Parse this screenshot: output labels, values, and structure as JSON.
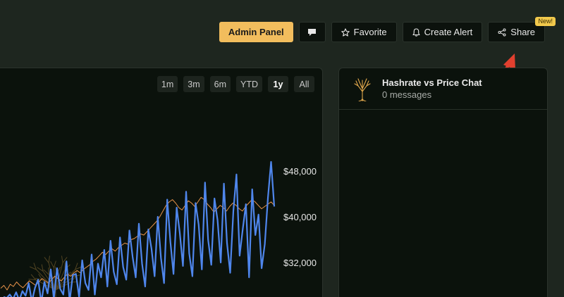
{
  "toolbar": {
    "admin_label": "Admin Panel",
    "comment_icon": "comment-icon",
    "favorite_label": "Favorite",
    "favorite_icon": "star-icon",
    "alert_label": "Create Alert",
    "alert_icon": "bell-icon",
    "share_label": "Share",
    "share_icon": "share-icon",
    "share_badge": "New!"
  },
  "ranges": [
    {
      "label": "1m",
      "active": false
    },
    {
      "label": "3m",
      "active": false
    },
    {
      "label": "6m",
      "active": false
    },
    {
      "label": "YTD",
      "active": false
    },
    {
      "label": "1y",
      "active": true
    },
    {
      "label": "All",
      "active": false
    }
  ],
  "chart_data": {
    "type": "line",
    "title": "",
    "xlabel": "",
    "ylabel": "",
    "ylim": [
      26000,
      52000
    ],
    "y_ticks": [
      "$48,000",
      "$40,000",
      "$32,000"
    ],
    "y_tick_values": [
      48000,
      40000,
      32000
    ],
    "series": [
      {
        "color": "#e8934a",
        "values": [
          27500,
          28000,
          27200,
          28200,
          27800,
          28600,
          28000,
          27600,
          28200,
          28800,
          28400,
          28000,
          28600,
          29200,
          28800,
          28400,
          29000,
          29600,
          29200,
          28800,
          29400,
          30000,
          29600,
          30200,
          30600,
          30200,
          30800,
          31200,
          31600,
          32200,
          32600,
          33200,
          33800,
          33400,
          34000,
          34400,
          34000,
          34600,
          35000,
          35400,
          35200,
          36000,
          36200,
          36600,
          37000,
          36800,
          37400,
          38000,
          38600,
          39200,
          40000,
          41000,
          42000,
          42600,
          43000,
          42400,
          41600,
          41200,
          42000,
          42800,
          42400,
          41800,
          42600,
          43400,
          43000,
          42200,
          41600,
          40800,
          41400,
          42000,
          41600,
          41000,
          41800,
          42400,
          42000,
          41400,
          41000,
          41800,
          42400,
          43000,
          42600,
          42000,
          41400,
          41800,
          42200,
          42600,
          42000
        ]
      },
      {
        "color": "#4f86ec",
        "values": [
          26000,
          25800,
          26400,
          25600,
          26800,
          25400,
          27000,
          26200,
          28400,
          25200,
          27600,
          29000,
          25000,
          28600,
          26600,
          30800,
          25600,
          31000,
          27400,
          26400,
          32200,
          25200,
          29800,
          30000,
          26000,
          32400,
          28400,
          27200,
          33400,
          26400,
          31800,
          29400,
          34200,
          27800,
          35800,
          30400,
          28200,
          36400,
          31200,
          29000,
          37600,
          33000,
          29400,
          38800,
          31800,
          27800,
          37800,
          34400,
          29600,
          40000,
          32800,
          28400,
          43000,
          35600,
          30000,
          41600,
          37200,
          31400,
          44400,
          33600,
          29600,
          42400,
          38600,
          30800,
          46000,
          36000,
          31600,
          43200,
          39400,
          32000,
          45800,
          35400,
          30200,
          41000,
          47400,
          33200,
          37800,
          42200,
          29400,
          44800,
          36800,
          40400,
          31000,
          35200,
          43400,
          49600,
          41800
        ]
      }
    ]
  },
  "chat": {
    "avatar_icon": "tree-icon",
    "title": "Hashrate vs Price Chat",
    "subtitle": "0 messages"
  },
  "annotation": {
    "arrow_color": "#e2402f"
  }
}
